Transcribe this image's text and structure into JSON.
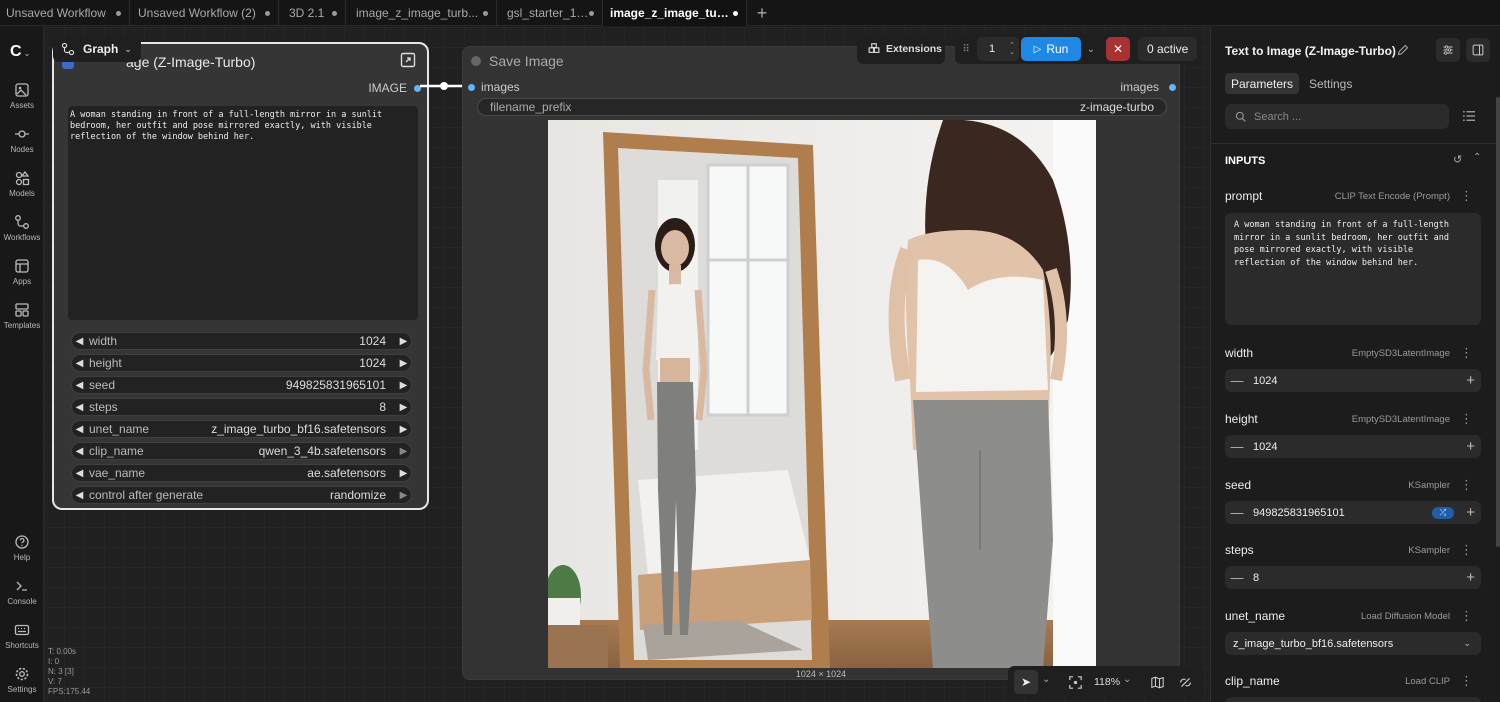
{
  "tabs": [
    {
      "label": "Unsaved Workflow"
    },
    {
      "label": "Unsaved Workflow (2)"
    },
    {
      "label": "3D 2.1"
    },
    {
      "label": "image_z_image_turb..."
    },
    {
      "label": "gsl_starter_1_1"
    },
    {
      "label": "image_z_image_turbo",
      "active": true
    }
  ],
  "tab_add": "+",
  "sidebar": {
    "logo": "C",
    "items": [
      {
        "label": "Assets",
        "icon": "assets-icon"
      },
      {
        "label": "Nodes",
        "icon": "nodes-icon"
      },
      {
        "label": "Models",
        "icon": "models-icon"
      },
      {
        "label": "Workflows",
        "icon": "workflows-icon"
      },
      {
        "label": "Apps",
        "icon": "apps-icon"
      },
      {
        "label": "Templates",
        "icon": "templates-icon"
      }
    ],
    "bottom": [
      {
        "label": "Help",
        "icon": "help-icon"
      },
      {
        "label": "Console",
        "icon": "console-icon"
      },
      {
        "label": "Shortcuts",
        "icon": "keyboard-icon"
      },
      {
        "label": "Settings",
        "icon": "gear-icon"
      }
    ]
  },
  "stats": {
    "t": "T: 0.00s",
    "i": "I: 0",
    "n": "N: 3 [3]",
    "v": "V: 7",
    "fps": "FPS:175.44"
  },
  "graph_button": {
    "label": "Graph"
  },
  "node_text_to_image": {
    "title": "age (Z-Image-Turbo)",
    "output_label": "IMAGE",
    "prompt": "A woman standing in front of a full-length mirror in a sunlit\nbedroom, her outfit and pose mirrored exactly, with visible\nreflection of the window behind her.",
    "widgets": [
      {
        "name": "width",
        "value": "1024"
      },
      {
        "name": "height",
        "value": "1024"
      },
      {
        "name": "seed",
        "value": "949825831965101"
      },
      {
        "name": "steps",
        "value": "8"
      },
      {
        "name": "unet_name",
        "value": "z_image_turbo_bf16.safetensors"
      },
      {
        "name": "clip_name",
        "value": "qwen_3_4b.safetensors"
      },
      {
        "name": "vae_name",
        "value": "ae.safetensors"
      },
      {
        "name": "control after generate",
        "value": "randomize"
      }
    ]
  },
  "node_save_image": {
    "title": "Save Image",
    "input_label": "images",
    "output_label": "images",
    "filename_prefix_label": "filename_prefix",
    "filename_prefix_value": "z-image-turbo",
    "image_size": "1024 × 1024"
  },
  "toolbar": {
    "extensions": "Extensions",
    "batch_count": "1",
    "run": "Run",
    "active": "0 active"
  },
  "canvas_controls": {
    "zoom": "118%"
  },
  "right_panel": {
    "title": "Text to Image (Z-Image-Turbo)",
    "tab_parameters": "Parameters",
    "tab_settings": "Settings",
    "search_placeholder": "Search ...",
    "inputs_header": "INPUTS",
    "prompt": {
      "label": "prompt",
      "source": "CLIP Text Encode (Prompt)",
      "value": "A woman standing in front of a full-length\nmirror in a sunlit bedroom, her outfit and\npose mirrored exactly, with visible\nreflection of the window behind her."
    },
    "width": {
      "label": "width",
      "source": "EmptySD3LatentImage",
      "value": "1024"
    },
    "height": {
      "label": "height",
      "source": "EmptySD3LatentImage",
      "value": "1024"
    },
    "seed": {
      "label": "seed",
      "source": "KSampler",
      "value": "949825831965101"
    },
    "steps": {
      "label": "steps",
      "source": "KSampler",
      "value": "8"
    },
    "unet_name": {
      "label": "unet_name",
      "source": "Load Diffusion Model",
      "value": "z_image_turbo_bf16.safetensors"
    },
    "clip_name": {
      "label": "clip_name",
      "source": "Load CLIP"
    }
  },
  "colors": {
    "accent": "#1e88e5",
    "port": "#64b5f6",
    "cancel": "#a83232"
  }
}
